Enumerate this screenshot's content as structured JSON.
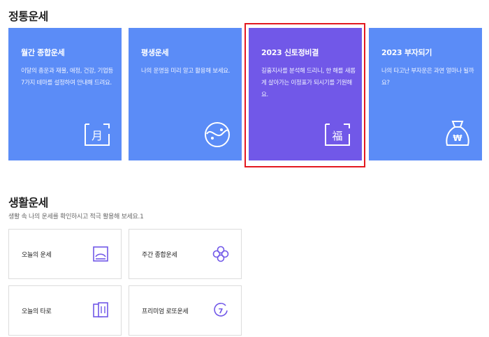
{
  "fortune": {
    "title": "정통운세",
    "cards": [
      {
        "title": "월간 종합운세",
        "desc": "이달의 총운과 재물, 애정, 건강, 기업등 7가지 테마를 설정하여 안내해 드려요."
      },
      {
        "title": "평생운세",
        "desc": "나의 운명을 미리 알고 활용해 보세요."
      },
      {
        "title": "2023 신토정비결",
        "desc": "길흉지사를 분석해 드리니, 한 해를 새롭게 살아가는 이정표가 되시기를 기원해요."
      },
      {
        "title": "2023 부자되기",
        "desc": "나의 타고난 부자운은 과연 얼마나 될까요?"
      }
    ],
    "card_icons": [
      "calendar-month-icon",
      "yin-yang-face-icon",
      "fortune-blessing-icon",
      "money-bag-icon"
    ],
    "card_colors": [
      "#5b8cf7",
      "#5b8cf7",
      "#7158e8",
      "#5b8cf7"
    ],
    "highlight_color": "#e3181f"
  },
  "life": {
    "title": "생활운세",
    "subtitle": "생활 속 나의 운세를 확인하시고 적극 활용해 보세요.1",
    "items": [
      {
        "label": "오늘의 운세",
        "icon": "sunrise-frame-icon"
      },
      {
        "label": "주간 종합운세",
        "icon": "clover-icon"
      },
      {
        "label": "오늘의 타로",
        "icon": "tarot-cards-icon"
      },
      {
        "label": "프리미엄 로또운세",
        "icon": "lucky-seven-icon"
      }
    ],
    "accent_color": "#7158e8"
  }
}
